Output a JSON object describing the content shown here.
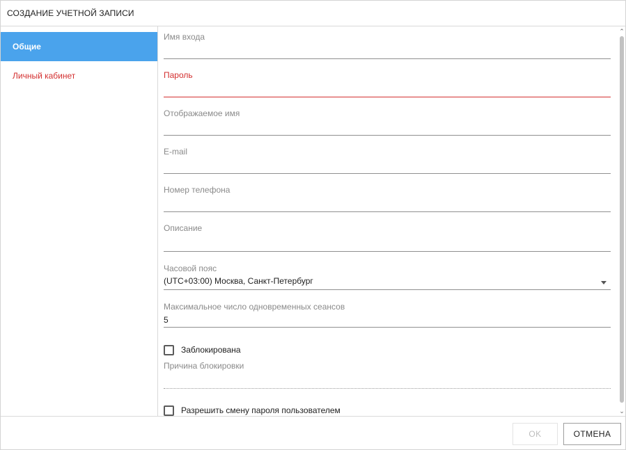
{
  "dialog": {
    "title": "СОЗДАНИЕ УЧЕТНОЙ ЗАПИСИ"
  },
  "sidebar": {
    "items": [
      {
        "label": "Общие",
        "state": "active"
      },
      {
        "label": "Личный кабинет",
        "state": "error"
      }
    ]
  },
  "form": {
    "login": {
      "label": "Имя входа",
      "value": ""
    },
    "password": {
      "label": "Пароль",
      "value": "",
      "state": "error"
    },
    "display_name": {
      "label": "Отображаемое имя",
      "value": ""
    },
    "email": {
      "label": "E-mail",
      "value": ""
    },
    "phone": {
      "label": "Номер телефона",
      "value": ""
    },
    "description": {
      "label": "Описание",
      "value": ""
    },
    "timezone": {
      "label": "Часовой пояс",
      "value": "(UTC+03:00) Москва, Санкт-Петербург"
    },
    "max_sessions": {
      "label": "Максимальное число одновременных сеансов",
      "value": "5"
    },
    "blocked": {
      "label": "Заблокирована",
      "checked": false
    },
    "block_reason": {
      "label": "Причина блокировки",
      "value": ""
    },
    "allow_password_change": {
      "label": "Разрешить смену пароля пользователем",
      "checked": false
    }
  },
  "footer": {
    "ok_label": "OK",
    "cancel_label": "ОТМЕНА",
    "ok_enabled": false
  },
  "colors": {
    "accent": "#4aa3ec",
    "error": "#d32f2f"
  },
  "icons": {
    "scroll_up": "chevron-up-icon",
    "scroll_down": "chevron-down-icon",
    "dropdown": "dropdown-arrow-icon"
  }
}
